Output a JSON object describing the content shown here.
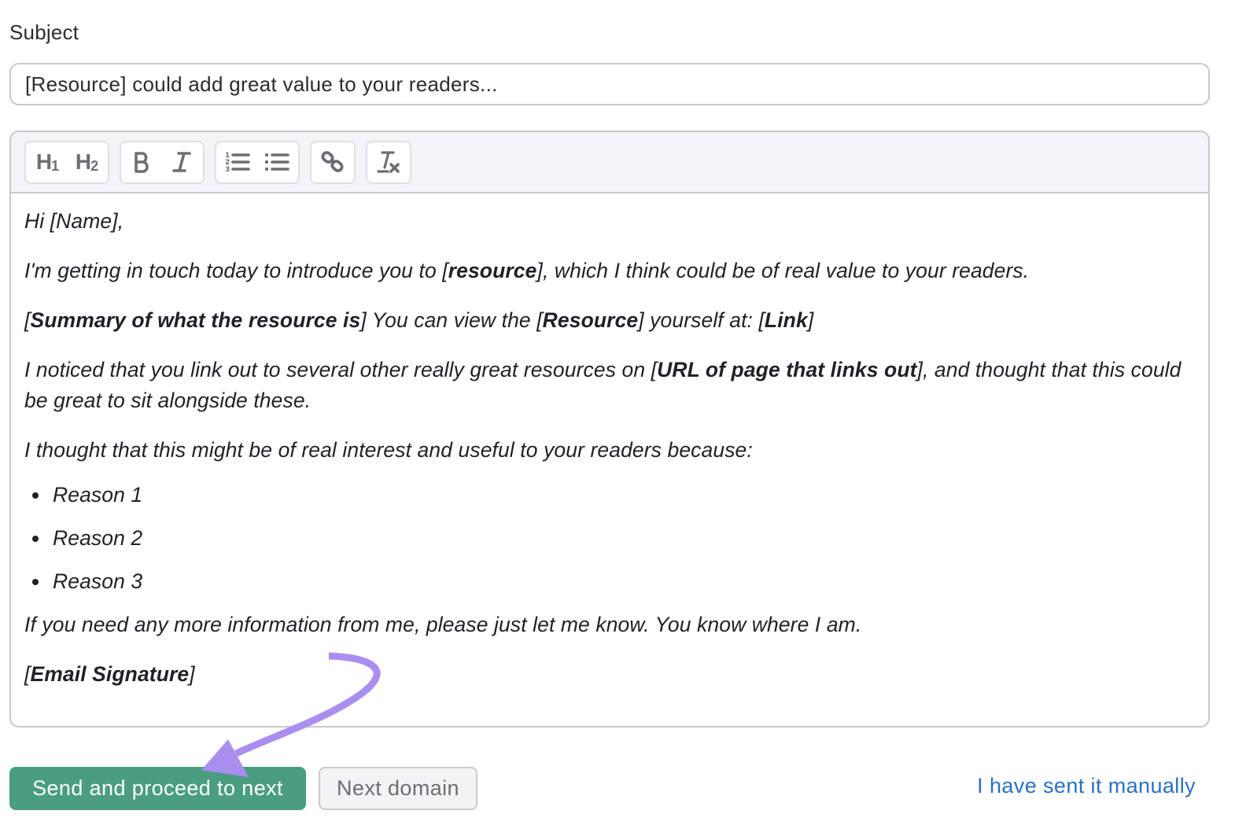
{
  "subject": {
    "label": "Subject",
    "value": "[Resource] could add great value to your readers..."
  },
  "toolbar": {
    "groups": [
      {
        "buttons": [
          {
            "icon": "heading-1-icon",
            "label": "H1"
          },
          {
            "icon": "heading-2-icon",
            "label": "H2"
          }
        ]
      },
      {
        "buttons": [
          {
            "icon": "bold-icon",
            "label": "B"
          },
          {
            "icon": "italic-icon",
            "label": "I"
          }
        ]
      },
      {
        "buttons": [
          {
            "icon": "ordered-list-icon"
          },
          {
            "icon": "bullet-list-icon"
          }
        ]
      },
      {
        "buttons": [
          {
            "icon": "link-icon"
          }
        ]
      },
      {
        "buttons": [
          {
            "icon": "clear-format-icon"
          }
        ]
      }
    ]
  },
  "email_body": {
    "greeting": "Hi [Name],",
    "p1": {
      "a": "I'm getting in touch today to introduce you to [",
      "b": "resource",
      "c": "], which I think could be of real value to your readers."
    },
    "p2": {
      "a": "[",
      "b": "Summary of what the resource is",
      "c": "] You can view the [",
      "d": "Resource",
      "e": "] yourself at: [",
      "f": "Link",
      "g": "]"
    },
    "p3": {
      "a": "I noticed that you link out to several other really great resources on [",
      "b": "URL of page that links out",
      "c": "], and thought that this could be great to sit alongside these."
    },
    "p4": "I thought that this might be of real interest and useful to your readers because:",
    "reasons": [
      "Reason 1",
      "Reason 2",
      "Reason 3"
    ],
    "p5": "If you need any more information from me, please just let me know. You know where I am.",
    "signature": {
      "a": "[",
      "b": "Email Signature",
      "c": "]"
    }
  },
  "actions": {
    "send_label": "Send and proceed to next",
    "next_label": "Next domain",
    "manual_label": "I have sent it manually"
  },
  "colors": {
    "primary": "#4a9d80",
    "link": "#2a6fc4",
    "annotation_arrow": "#a98ef0"
  }
}
